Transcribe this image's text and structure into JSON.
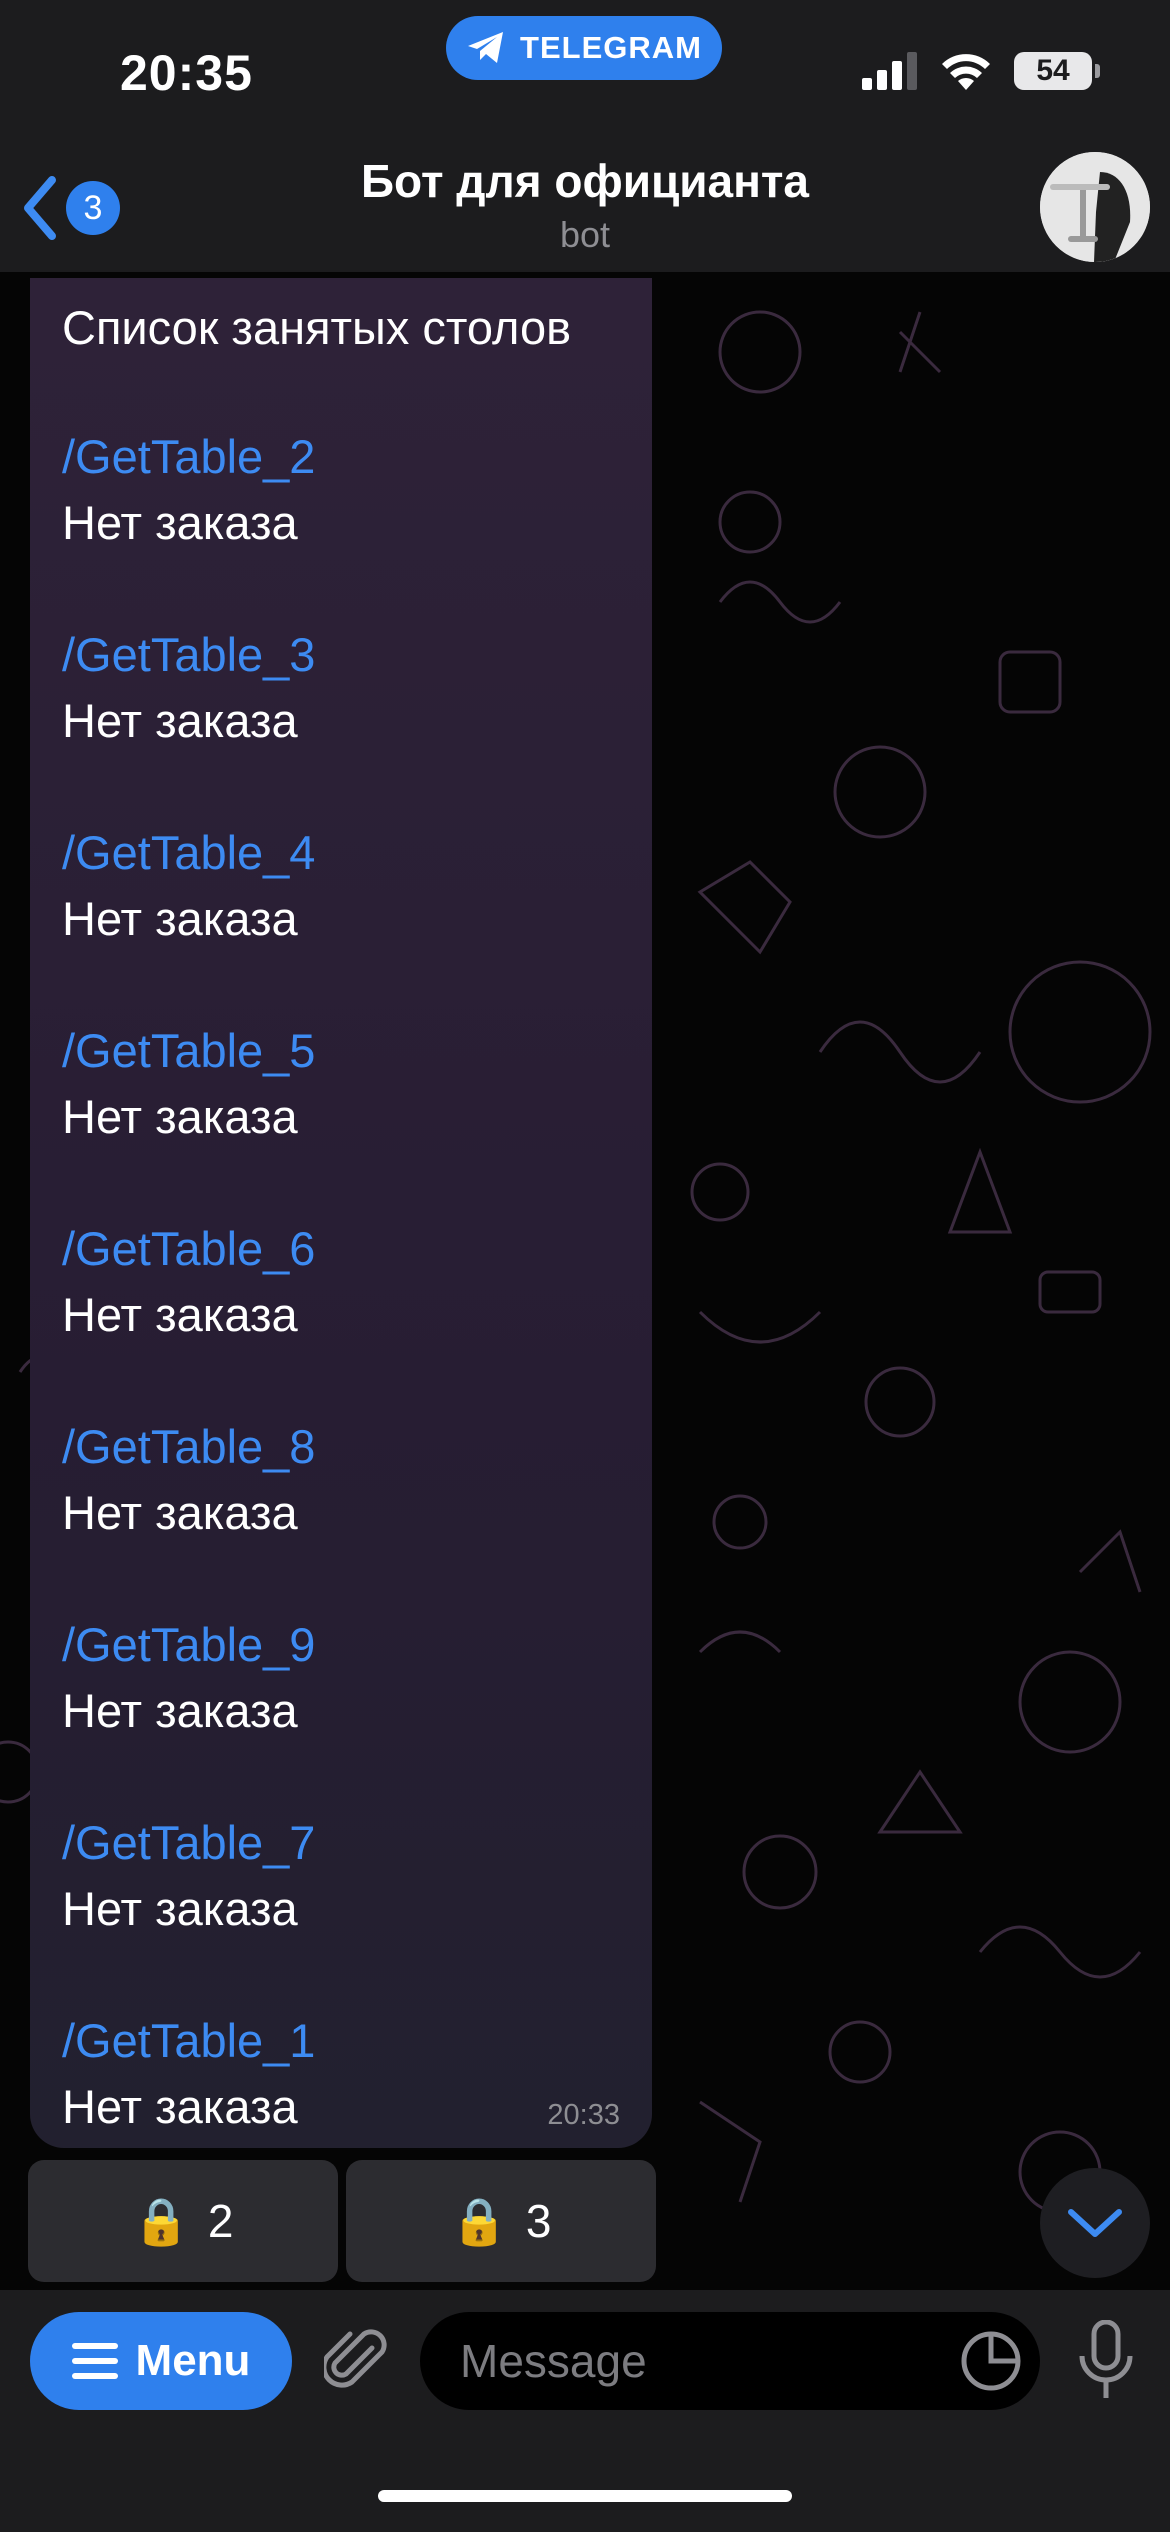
{
  "status_bar": {
    "time": "20:35",
    "banner_label": "TELEGRAM",
    "battery": "54"
  },
  "header": {
    "back_badge": "3",
    "title": "Бот для официанта",
    "subtitle": "bot"
  },
  "message": {
    "heading": "Список занятых столов",
    "entries": [
      {
        "command": "/GetTable_2",
        "status": "Нет заказа"
      },
      {
        "command": "/GetTable_3",
        "status": "Нет заказа"
      },
      {
        "command": "/GetTable_4",
        "status": "Нет заказа"
      },
      {
        "command": "/GetTable_5",
        "status": "Нет заказа"
      },
      {
        "command": "/GetTable_6",
        "status": "Нет заказа"
      },
      {
        "command": "/GetTable_8",
        "status": "Нет заказа"
      },
      {
        "command": "/GetTable_9",
        "status": "Нет заказа"
      },
      {
        "command": "/GetTable_7",
        "status": "Нет заказа"
      },
      {
        "command": "/GetTable_1",
        "status": "Нет заказа"
      }
    ],
    "time": "20:33"
  },
  "keyboard": {
    "buttons": [
      {
        "icon": "🔒",
        "label": "2"
      },
      {
        "icon": "🔒",
        "label": "3"
      }
    ]
  },
  "input_bar": {
    "menu_label": "Menu",
    "placeholder": "Message"
  },
  "colors": {
    "accent": "#2f80ed",
    "link": "#3d8bf2",
    "bubble": "#2b2035"
  }
}
